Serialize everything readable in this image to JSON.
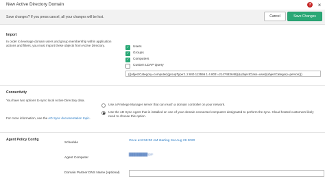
{
  "header": {
    "title": "New Active Directory Domain",
    "help_icon": "help-icon",
    "close_icon": "close-icon"
  },
  "notice": {
    "text": "Save changes? If you press cancel, all your changes will be lost.",
    "cancel_label": "Cancel",
    "save_label": "Save Changes"
  },
  "colors": {
    "accent": "#2aa876",
    "link": "#2a7bc4",
    "help": "#c62828"
  },
  "import": {
    "title": "Import",
    "description": "In order to leverage domain users and group membership within application actions and filters, you must import these objects from Active Directory.",
    "options": [
      {
        "label": "Users",
        "checked": true
      },
      {
        "label": "Groups",
        "checked": true
      },
      {
        "label": "Computers",
        "checked": true
      },
      {
        "label": "Custom LDAP Query",
        "checked": false
      }
    ],
    "ldap_query": "(|(objectCategory=computer)(groupType:1.2.840.113556.1.4.803:=2147483648)(&(objectClass=user)(objectCategory=person)))"
  },
  "connectivity": {
    "title": "Connectivity",
    "description": "You have two options to sync local Active Directory data.",
    "more_info_prefix": "For more information, see the ",
    "more_info_link": "AD Sync documentation topic",
    "more_info_suffix": ".",
    "options": [
      {
        "label": "Use a Privilege Manager server that can reach a domain controller on your network.",
        "selected": false
      },
      {
        "label": "Use the AD Sync Agent that is installed on one of your domain connected computers designated to perform the sync. Cloud hosted customers likely need to choose this option.",
        "selected": true
      }
    ]
  },
  "agent_policy": {
    "title": "Agent Policy Config",
    "schedule_label": "Schedule",
    "schedule_value": "Once at 6:59:00 AM starting Sat Aug 29 2020",
    "agent_computer_label": "Agent Computer",
    "agent_computer_value": "████████\\DP",
    "dns_label": "Domain Partner DNS Name (optional)",
    "dns_value": ""
  }
}
